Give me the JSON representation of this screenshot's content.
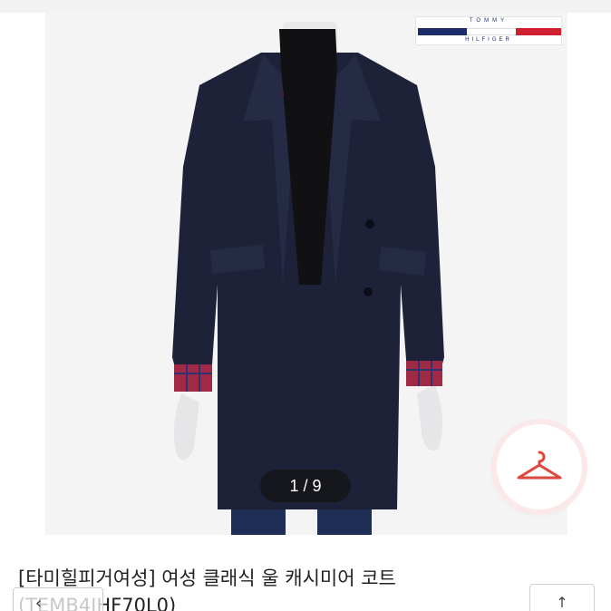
{
  "product": {
    "brand_logo_top": "TOMMY",
    "brand_logo_bottom": "HILFIGER",
    "image_counter": "1 / 9",
    "title": "[타미힐피거여성] 여성 클래식 울 캐시미어 코트",
    "code": "(TEMB4JHF70L0)"
  },
  "icons": {
    "hanger": "hanger-icon",
    "share": "share-icon",
    "overlay_arrow": "arrow-left-icon"
  },
  "colors": {
    "accent": "#e0463c",
    "coat": "#1e2238",
    "flag_navy": "#1c2b6b",
    "flag_red": "#d0202f"
  }
}
